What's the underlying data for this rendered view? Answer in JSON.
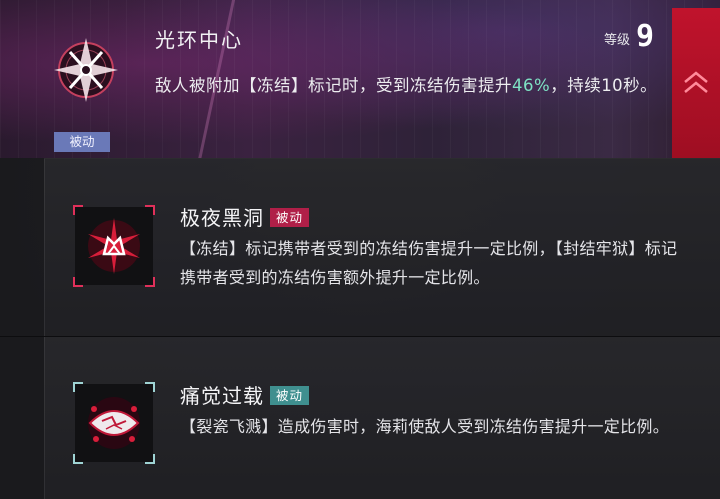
{
  "header": {
    "title": "光环中心",
    "level_label": "等级",
    "level_value": "9",
    "desc_part1": "敌人被附加【冻结】标记时，受到冻结伤害提升",
    "desc_highlight": "46%",
    "desc_part2": "，持续10秒。",
    "tag": "被动",
    "highlight_color": "#7ee2c4"
  },
  "skills": [
    {
      "name": "极夜黑洞",
      "tag": "被动",
      "icon": "crystal-burst-icon",
      "accent": "#e0305a",
      "description": "【冻结】标记携带者受到的冻结伤害提升一定比例，【封结牢狱】标记携带者受到的冻结伤害额外提升一定比例。"
    },
    {
      "name": "痛觉过载",
      "tag": "被动",
      "icon": "cracked-eye-icon",
      "accent": "#9fd4d4",
      "description": "【裂瓷飞溅】造成伤害时，海莉使敌人受到冻结伤害提升一定比例。"
    }
  ]
}
